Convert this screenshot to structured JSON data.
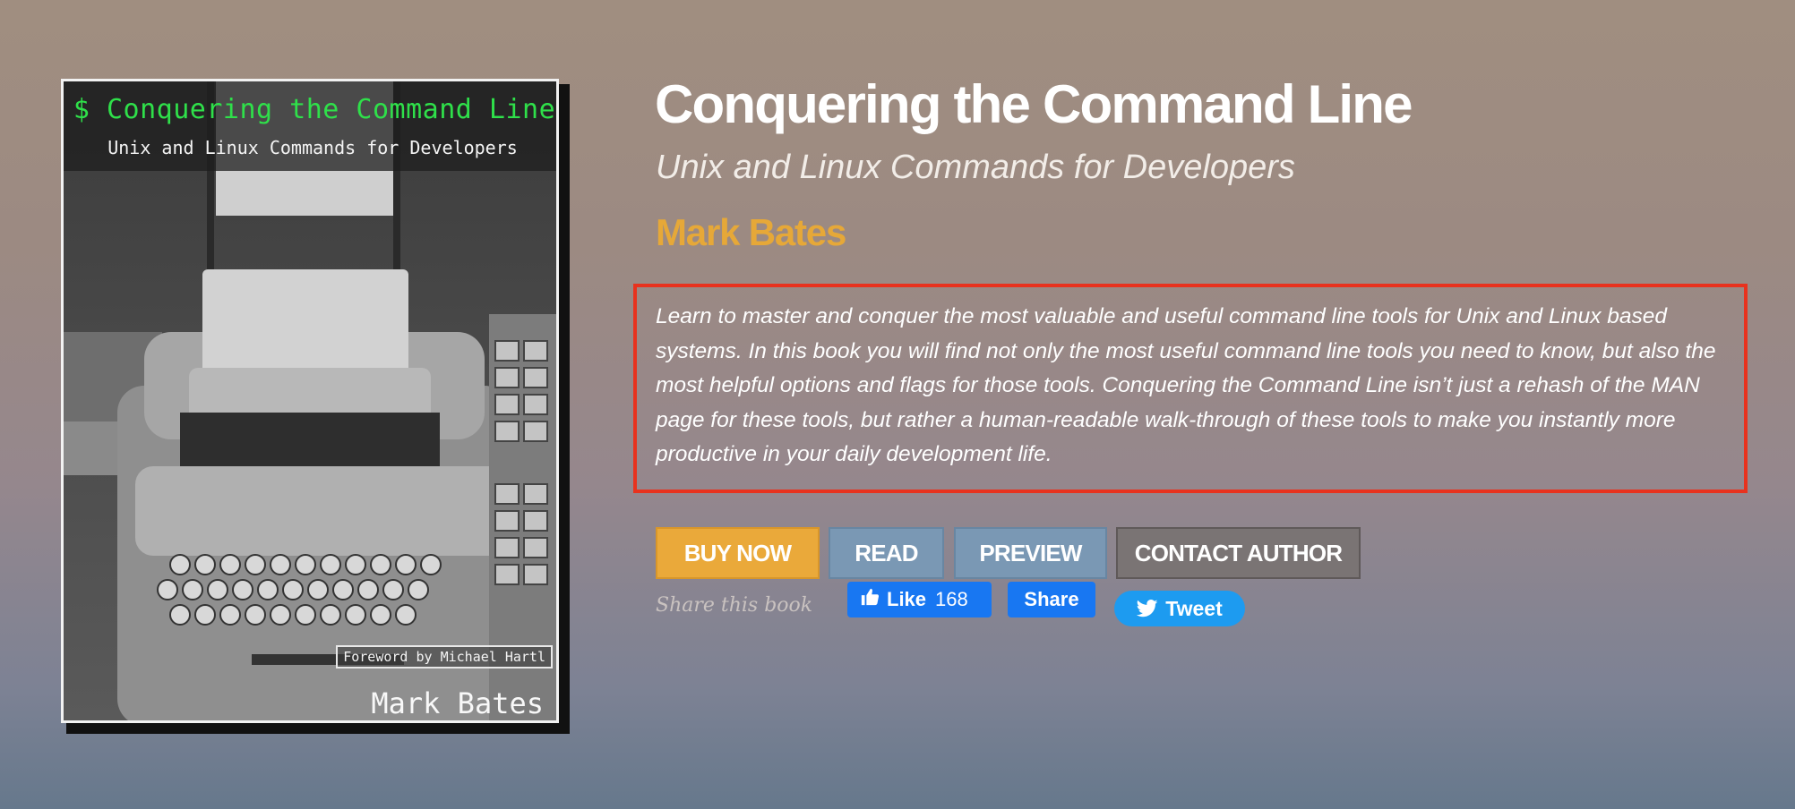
{
  "cover": {
    "title": "$ Conquering the Command Line",
    "subtitle": "Unix and Linux Commands for Developers",
    "foreword": "Foreword by Michael Hartl",
    "author": "Mark Bates"
  },
  "book": {
    "title": "Conquering the Command Line",
    "subtitle": "Unix and Linux Commands for Developers",
    "author": "Mark Bates",
    "description": "Learn to master and conquer the most valuable and useful command line tools for Unix and Linux based systems. In this book you will find not only the most useful command line tools you need to know, but also the most helpful options and flags for those tools. Conquering the Command Line isn’t just a rehash of the MAN page for these tools, but rather a human-readable walk-through of these tools to make you instantly more productive in your daily development life."
  },
  "buttons": {
    "buy": "BUY NOW",
    "read": "READ",
    "preview": "PREVIEW",
    "contact": "CONTACT AUTHOR"
  },
  "share": {
    "label": "Share this book",
    "like_label": "Like",
    "like_count": "168",
    "share_label": "Share",
    "tweet_label": "Tweet"
  },
  "colors": {
    "accent_orange": "#eaa93a",
    "button_blue": "#7a98b4",
    "button_gray": "#7a7474",
    "facebook_blue": "#1877f2",
    "twitter_blue": "#1d9bf0",
    "highlight_red": "#e8321e",
    "cover_title_green": "#2fe04a"
  },
  "icons": {
    "fb_like": "thumbs-up-icon",
    "tweet": "twitter-bird-icon"
  }
}
